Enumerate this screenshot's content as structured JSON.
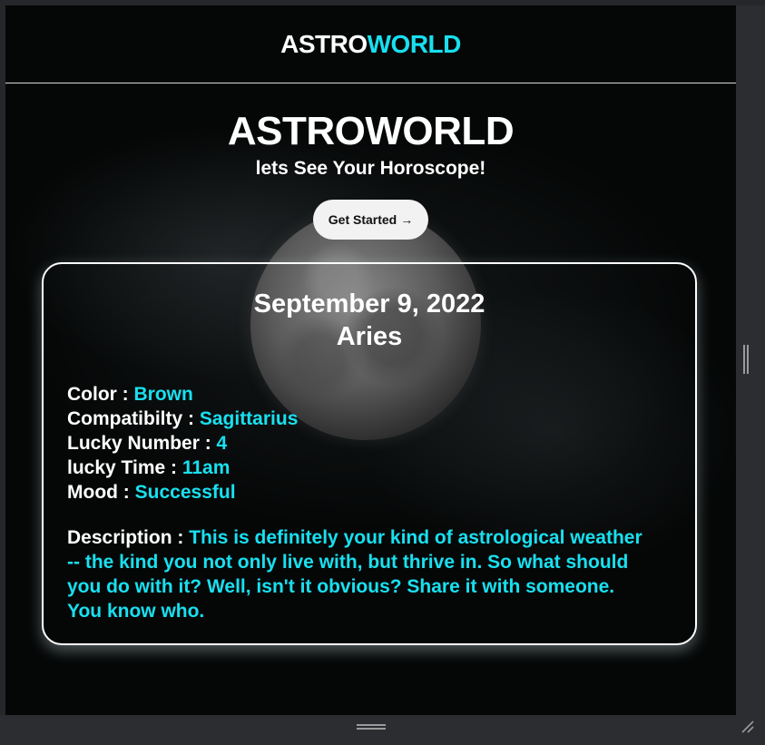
{
  "navbar": {
    "brand_part1": "ASTRO",
    "brand_part2": "WORLD"
  },
  "hero": {
    "title": "ASTROWORLD",
    "subtitle": "lets See Your Horoscope!",
    "cta_label": "Get Started",
    "cta_icon": "→"
  },
  "horoscope": {
    "date": "September 9, 2022",
    "sign": "Aries",
    "color_label": "Color :",
    "color_value": "Brown",
    "compat_label": "Compatibilty :",
    "compat_value": "Sagittarius",
    "number_label": "Lucky Number :",
    "number_value": "4",
    "time_label": "lucky Time :",
    "time_value": "11am",
    "mood_label": "Mood :",
    "mood_value": "Successful",
    "desc_label": "Description :",
    "desc_value": "This is definitely your kind of astrological weather -- the kind you not only live with, but thrive in. So what should you do with it? Well, isn't it obvious? Share it with someone. You know who."
  },
  "theme": {
    "accent": "#18e0f0",
    "background": "#050707",
    "text": "#ffffff"
  }
}
